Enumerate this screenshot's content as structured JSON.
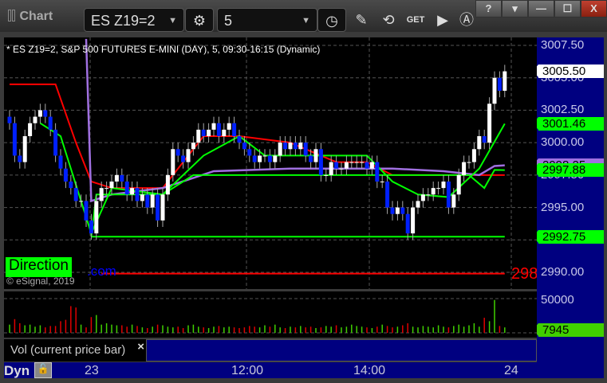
{
  "window": {
    "title": "Chart",
    "help": "?",
    "restore_down": "▾",
    "minimize": "—",
    "maximize": "☐",
    "close": "X"
  },
  "toolbar": {
    "symbol": "ES Z19=2",
    "interval": "5",
    "get_label": "GET"
  },
  "chart": {
    "header": "* ES Z19=2, S&P 500 FUTURES E-MINI (DAY), 5, 09:30-16:15 (Dynamic)",
    "copyright": "© eSignal, 2019",
    "direction_label": "Direction",
    "direction_suffix": ".com",
    "cut_label": "298"
  },
  "price_axis": {
    "labels": [
      "3007.50",
      "3005.00",
      "3002.50",
      "3000.00",
      "2997.50",
      "2995.00",
      "2992.50",
      "2990.00"
    ],
    "tags": [
      {
        "text": "3005.50",
        "color": "#ffffff"
      },
      {
        "text": "3001.46",
        "color": "#00ff00"
      },
      {
        "text": "2998.25",
        "color": "#a070e0"
      },
      {
        "text": "2997.88",
        "color": "#00ff00"
      },
      {
        "text": "2992.75",
        "color": "#00ff00"
      }
    ]
  },
  "volume_axis": {
    "labels": [
      "50000"
    ],
    "tag": "7945"
  },
  "volume_pane": {
    "label": "Vol (current price bar)",
    "close": "×"
  },
  "time_axis": {
    "mode": "Dyn",
    "labels": [
      "23",
      "12:00",
      "14:00",
      "24"
    ]
  },
  "chart_data": {
    "type": "candlestick",
    "ylim": [
      2989.5,
      3008
    ],
    "closes": [
      3001.5,
      2999,
      2998.5,
      3000.5,
      3001.5,
      3002,
      3002.5,
      3002,
      3001,
      2999,
      2998,
      2997,
      2996.5,
      2995.5,
      2995.5,
      2994,
      2993,
      2995.5,
      2996.5,
      2996.5,
      2997,
      2997.5,
      2997,
      2996,
      2996.5,
      2995.5,
      2996,
      2995,
      2996,
      2994,
      2996,
      2997.5,
      2999.5,
      2999,
      2998.5,
      2999.5,
      3000,
      3001,
      3000.5,
      3001,
      3001.5,
      3000.5,
      3001,
      3001.5,
      3000.5,
      3000,
      2999.5,
      2999,
      2998.5,
      2999,
      2999,
      2998.5,
      2999,
      3000,
      2999.5,
      3000,
      2999.5,
      3000,
      2999,
      2998.5,
      2999.5,
      2997.5,
      2997.5,
      2998.5,
      2998,
      2998,
      2998.5,
      2998.5,
      2998.5,
      2998.5,
      2998,
      2998.5,
      2997,
      2997,
      2995,
      2994.5,
      2995,
      2994.5,
      2993,
      2995,
      2995.5,
      2996,
      2996,
      2996.5,
      2996.5,
      2997,
      2995,
      2996,
      2997.5,
      2998.5,
      2998.5,
      2999.5,
      3000.5,
      3000,
      3003,
      3005,
      3004,
      3005.5
    ],
    "volumes": [
      12000,
      20000,
      14000,
      11000,
      12000,
      9000,
      11000,
      8000,
      10000,
      10000,
      17000,
      19000,
      39000,
      37000,
      12000,
      8000,
      23000,
      26000,
      12000,
      14000,
      12000,
      11000,
      11000,
      9000,
      12000,
      10000,
      8000,
      7000,
      9000,
      12000,
      11000,
      9000,
      8000,
      9000,
      7000,
      11000,
      12000,
      9000,
      8000,
      7000,
      9000,
      10000,
      8000,
      9000,
      8000,
      7000,
      8000,
      10000,
      9000,
      8000,
      11000,
      9000,
      12000,
      8000,
      7000,
      9000,
      8000,
      10000,
      8000,
      9000,
      7000,
      8000,
      10000,
      9000,
      11000,
      8000,
      9000,
      12000,
      10000,
      9000,
      8000,
      7000,
      9000,
      12000,
      10000,
      8000,
      9000,
      11000,
      14000,
      9000,
      8000,
      10000,
      9000,
      8000,
      11000,
      9000,
      8000,
      10000,
      12000,
      9000,
      11000,
      14000,
      9000,
      22000,
      17000,
      48000,
      10000,
      7945
    ],
    "lines": [
      {
        "name": "red-ma",
        "color": "#ff0000",
        "points": [
          [
            0,
            3004.5
          ],
          [
            9,
            3004.5
          ],
          [
            13,
            3000
          ],
          [
            16,
            2997
          ],
          [
            20,
            2996.5
          ],
          [
            30,
            2996.5
          ],
          [
            38,
            3000.5
          ],
          [
            45,
            3000.5
          ],
          [
            55,
            3000
          ],
          [
            64,
            2998.5
          ],
          [
            70,
            2998.5
          ],
          [
            75,
            2997.5
          ],
          [
            80,
            2997.5
          ],
          [
            97,
            2997.5
          ]
        ]
      },
      {
        "name": "purple-vwap",
        "color": "#a070e0",
        "points": [
          [
            15,
            3008
          ],
          [
            16,
            2995.5
          ],
          [
            20,
            2996
          ],
          [
            30,
            2996.5
          ],
          [
            40,
            2997.8
          ],
          [
            55,
            2998
          ],
          [
            75,
            2998
          ],
          [
            85,
            2997.8
          ],
          [
            92,
            2997.5
          ],
          [
            95,
            2998.2
          ],
          [
            97,
            2998.25
          ]
        ]
      },
      {
        "name": "green-fast",
        "color": "#00ff00",
        "points": [
          [
            6,
            3001.5
          ],
          [
            10,
            3000.5
          ],
          [
            16,
            2993
          ],
          [
            20,
            2996.5
          ],
          [
            30,
            2996
          ],
          [
            38,
            2999
          ],
          [
            45,
            3000.5
          ],
          [
            50,
            2999
          ],
          [
            70,
            2999
          ],
          [
            75,
            2997
          ],
          [
            80,
            2996
          ],
          [
            86,
            2995.8
          ],
          [
            92,
            2998
          ],
          [
            97,
            3001.46
          ]
        ]
      },
      {
        "name": "green-step",
        "color": "#00ff00",
        "points": [
          [
            16,
            2992.75
          ],
          [
            17,
            2996
          ],
          [
            30,
            2996
          ],
          [
            36,
            2997.5
          ],
          [
            80,
            2997.5
          ],
          [
            90,
            2997.5
          ],
          [
            93,
            2996.5
          ],
          [
            95,
            2997.9
          ],
          [
            97,
            2997.88
          ]
        ]
      },
      {
        "name": "green-support",
        "color": "#00ff00",
        "points": [
          [
            16,
            2992.75
          ],
          [
            97,
            2992.75
          ]
        ]
      },
      {
        "name": "red-level",
        "color": "#ff0000",
        "points": [
          [
            18,
            2989.9
          ],
          [
            97,
            2989.9
          ]
        ]
      }
    ]
  }
}
